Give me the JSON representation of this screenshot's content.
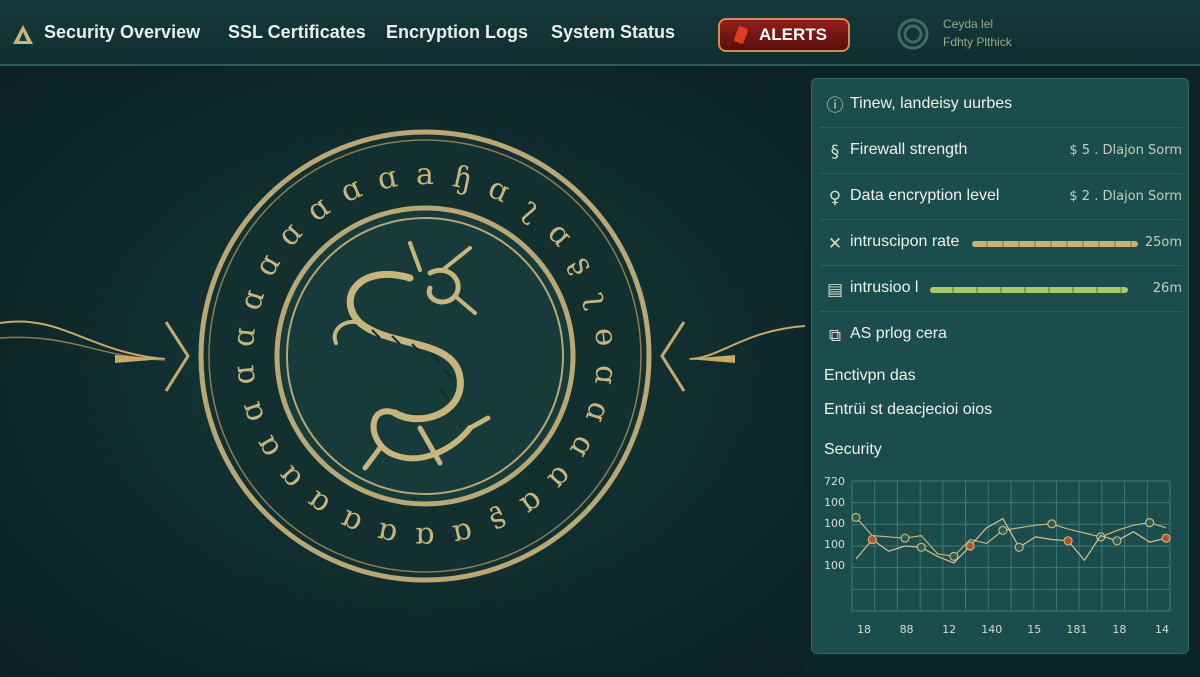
{
  "nav": {
    "items": [
      "Security Overview",
      "SSL Certificates",
      "Encryption Logs",
      "System Status"
    ],
    "alerts_label": "ALERTS",
    "profile_lines": [
      "Ceyda lel",
      "Fdhty Plthick"
    ]
  },
  "colors": {
    "accent_gold": "#c8b57e",
    "alert_red": "#8f1f1a",
    "panel_teal": "#1c4d4d",
    "bar_gold": "#c9b27a",
    "bar_green": "#a7c96a"
  },
  "seal": {
    "glyphs": [
      "a",
      "ɧ",
      "ɑ",
      "ʅ",
      "ɑ",
      "ʂ",
      "ʅ",
      "ɵ",
      "ɑ",
      "ɑ",
      "ɑ",
      "ɑ",
      "ɑ",
      "ʂ",
      "ɑ",
      "ɑ",
      "ɑ",
      "ɑ",
      "ɑ",
      "ɑ",
      "ɑ",
      "ɑ",
      "ɑ",
      "ɑ",
      "ɑ",
      "ɑ",
      "ɑ",
      "ɑ",
      "ɑ",
      "ɑ"
    ],
    "emblem": "dragon-icon"
  },
  "panel": {
    "rows": [
      {
        "icon": "info-icon",
        "label": "Tinew, landeisy uurbes",
        "value": ""
      },
      {
        "icon": "shield-icon",
        "label": "Firewall strength",
        "value": "$ 5 . Dlajon Sorm"
      },
      {
        "icon": "key-icon",
        "label": "Data encryption level",
        "value": "$ 2 . Dlajon Sorm"
      },
      {
        "icon": "close-icon",
        "label": "intruscipon rate",
        "value": "25om",
        "bar": 0.95
      },
      {
        "icon": "log-icon",
        "label": "intrusioo l",
        "value": "26m",
        "bar": 0.92
      },
      {
        "icon": "cube-icon",
        "label": "AS prlog cera",
        "value": ""
      }
    ],
    "text_lines": [
      "Enctivpn das",
      "Entrüi st deacjecioi oios"
    ],
    "chart_title": "Security"
  },
  "chart_data": {
    "type": "line",
    "title": "Security",
    "y_tick_labels": [
      "720",
      "100",
      "100",
      "100",
      "100"
    ],
    "x_tick_labels": [
      "18",
      "88",
      "12",
      "140",
      "15",
      "181",
      "18",
      "14"
    ],
    "series": [
      {
        "values": [
          0.72,
          0.58,
          0.57,
          0.56,
          0.58,
          0.44,
          0.42,
          0.55,
          0.52,
          0.62,
          0.64,
          0.66,
          0.67,
          0.63,
          0.6,
          0.57,
          0.62,
          0.66,
          0.68,
          0.64
        ]
      },
      {
        "values": [
          0.4,
          0.55,
          0.46,
          0.5,
          0.49,
          0.42,
          0.37,
          0.5,
          0.64,
          0.71,
          0.49,
          0.57,
          0.55,
          0.54,
          0.39,
          0.58,
          0.54,
          0.61,
          0.53,
          0.56
        ]
      }
    ],
    "grid": true
  }
}
